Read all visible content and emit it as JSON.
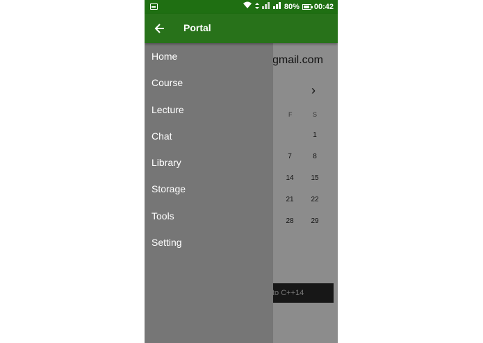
{
  "status_bar": {
    "battery": "80%",
    "time": "00:42"
  },
  "app": {
    "account_suffix": "gmail.com",
    "next_month_icon": "chevron-right-icon",
    "weekdays": [
      "F",
      "S"
    ],
    "calendar_rows": [
      [
        "",
        "1"
      ],
      [
        "7",
        "8"
      ],
      [
        "14",
        "15"
      ],
      [
        "21",
        "22"
      ],
      [
        "28",
        "29"
      ]
    ],
    "course_item": "to C++14"
  },
  "drawer": {
    "title": "Portal",
    "back_icon": "arrow-left-icon",
    "menu": [
      {
        "label": "Home"
      },
      {
        "label": "Course"
      },
      {
        "label": "Lecture"
      },
      {
        "label": "Chat"
      },
      {
        "label": "Library"
      },
      {
        "label": "Storage"
      },
      {
        "label": "Tools"
      },
      {
        "label": "Setting"
      }
    ]
  },
  "colors": {
    "status_bar": "#1f6f12",
    "toolbar": "#28721a",
    "drawer_bg": "#767676"
  }
}
